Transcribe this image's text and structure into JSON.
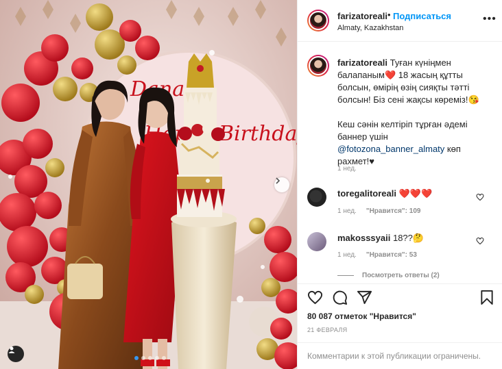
{
  "header": {
    "username": "farizatoreali",
    "separator": "•",
    "follow_label": "Подписаться",
    "location": "Almaty, Kazakhstan",
    "more_icon": "more-horizontal-icon"
  },
  "caption": {
    "username": "farizatoreali",
    "line1": "Туған күніңмен балапаным",
    "emoji1": "❤️",
    "line2": " 18 жасың құтты болсын, өмірің өзің сияқты тәтті болсын! Біз сені жақсы көреміз!",
    "emoji2": "😘",
    "line3": "Кеш сәнін келтіріп тұрған әдемі баннер үшін ",
    "mention": "@fotozona_banner_almaty",
    "line4": " көп рахмет!",
    "emoji3": "♥",
    "time": "1 нед."
  },
  "comments": [
    {
      "username": "toregalitoreali",
      "text": "❤️❤️❤️",
      "time": "1 нед.",
      "likes": "\"Нравится\": 109"
    },
    {
      "username": "makosssyaii",
      "text": "18??",
      "emoji": "🤔",
      "time": "1 нед.",
      "likes": "\"Нравится\": 53"
    }
  ],
  "view_replies": "Посмотреть ответы (2)",
  "actions": {
    "likes_text": "80 087 отметок \"Нравится\"",
    "date": "21 ФЕВРАЛЯ"
  },
  "footer": {
    "text": "Комментарии к этой публикации ограничены."
  },
  "photo": {
    "banner_text": "Happy Birthday!",
    "carousel_count": 5,
    "carousel_active": 1
  },
  "colors": {
    "link_blue": "#0095f6",
    "balloon_red": "#d41424",
    "gold": "#c9a227"
  }
}
